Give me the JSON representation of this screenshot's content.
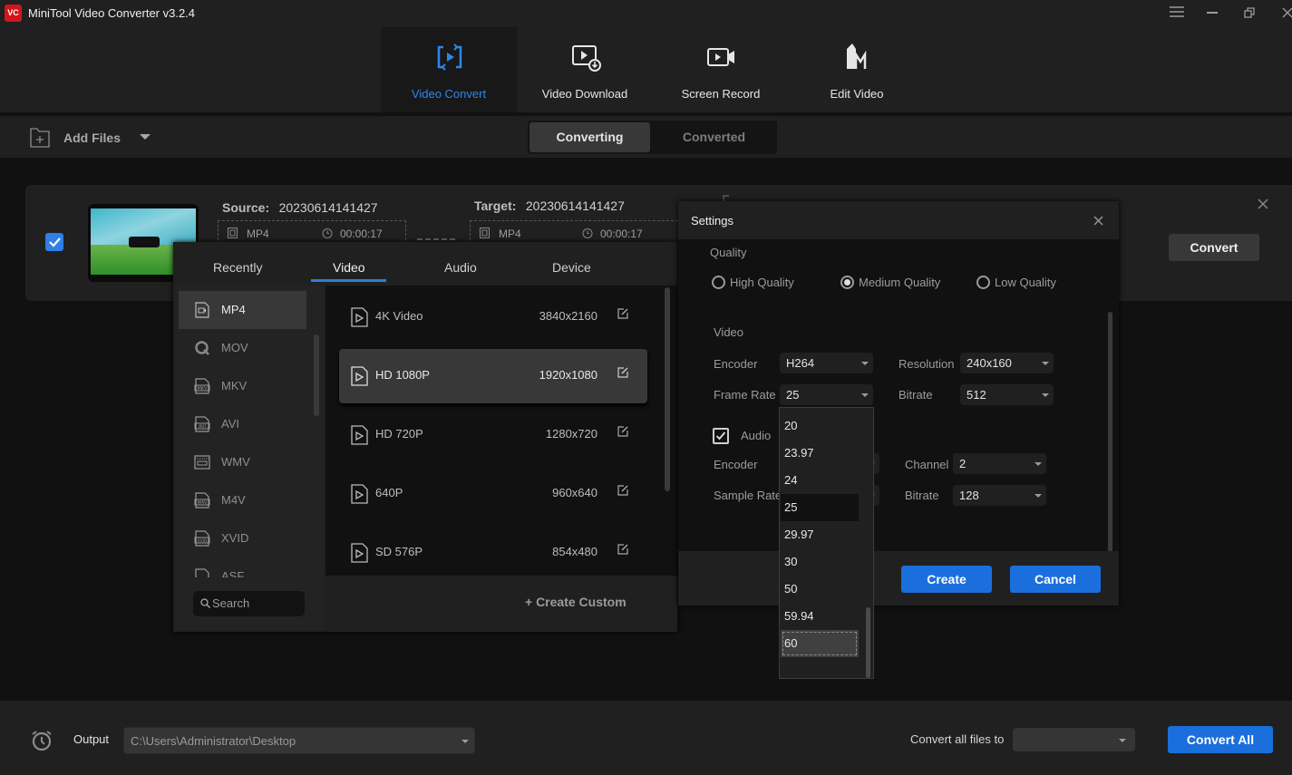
{
  "app": {
    "title": "MiniTool Video Converter v3.2.4",
    "logo_text": "VC"
  },
  "window_controls": {
    "menu": "menu-icon",
    "minimize": "minimize-icon",
    "restore": "restore-icon",
    "close": "close-icon"
  },
  "nav": {
    "tabs": [
      {
        "label": "Video Convert",
        "icon": "video-convert-icon",
        "active": true
      },
      {
        "label": "Video Download",
        "icon": "video-download-icon",
        "active": false
      },
      {
        "label": "Screen Record",
        "icon": "screen-record-icon",
        "active": false
      },
      {
        "label": "Edit Video",
        "icon": "edit-video-icon",
        "active": false
      }
    ]
  },
  "toolbar": {
    "add_files": "Add Files",
    "segments": [
      {
        "label": "Converting",
        "active": true
      },
      {
        "label": "Converted",
        "active": false
      }
    ]
  },
  "file": {
    "checked": true,
    "source_label": "Source:",
    "source_name": "20230614141427",
    "source_format": "MP4",
    "source_duration": "00:00:17",
    "target_label": "Target:",
    "target_name": "20230614141427",
    "target_format": "MP4",
    "target_duration": "00:00:17",
    "convert_label": "Convert"
  },
  "format_panel": {
    "tabs": [
      {
        "label": "Recently"
      },
      {
        "label": "Video",
        "active": true
      },
      {
        "label": "Audio"
      },
      {
        "label": "Device"
      }
    ],
    "formats": [
      {
        "label": "MP4",
        "selected": true
      },
      {
        "label": "MOV"
      },
      {
        "label": "MKV"
      },
      {
        "label": "AVI"
      },
      {
        "label": "WMV"
      },
      {
        "label": "M4V"
      },
      {
        "label": "XVID"
      },
      {
        "label": "ASF"
      }
    ],
    "search_placeholder": "Search",
    "presets": [
      {
        "name": "4K Video",
        "resolution": "3840x2160"
      },
      {
        "name": "HD 1080P",
        "resolution": "1920x1080",
        "selected": true
      },
      {
        "name": "HD 720P",
        "resolution": "1280x720"
      },
      {
        "name": "640P",
        "resolution": "960x640"
      },
      {
        "name": "SD 576P",
        "resolution": "854x480"
      }
    ],
    "create_custom": "+ Create Custom"
  },
  "settings": {
    "title": "Settings",
    "quality_label": "Quality",
    "quality_options": [
      {
        "label": "High Quality",
        "selected": false
      },
      {
        "label": "Medium Quality",
        "selected": true
      },
      {
        "label": "Low Quality",
        "selected": false
      }
    ],
    "video_label": "Video",
    "video": {
      "encoder_label": "Encoder",
      "encoder": "H264",
      "resolution_label": "Resolution",
      "resolution": "240x160",
      "frame_rate_label": "Frame Rate",
      "frame_rate": "25",
      "bitrate_label": "Bitrate",
      "bitrate": "512"
    },
    "audio_enabled": true,
    "audio_label": "Audio",
    "audio": {
      "encoder_label": "Encoder",
      "channel_label": "Channel",
      "channel": "2",
      "sample_rate_label": "Sample Rate",
      "bitrate_label": "Bitrate",
      "bitrate": "128"
    },
    "frame_rate_options": [
      "20",
      "23.97",
      "24",
      "25",
      "29.97",
      "30",
      "50",
      "59.94",
      "60"
    ],
    "frame_rate_current": "25",
    "frame_rate_hover": "60",
    "create_label": "Create",
    "cancel_label": "Cancel"
  },
  "bottom": {
    "output_label": "Output",
    "output_path": "C:\\Users\\Administrator\\Desktop",
    "convert_all_files_to": "Convert all files to",
    "convert_all_target": "",
    "convert_all_label": "Convert All"
  },
  "colors": {
    "accent": "#1a6fdd",
    "active_tab": "#2e86ea",
    "background": "#111111",
    "panel": "#202020"
  }
}
